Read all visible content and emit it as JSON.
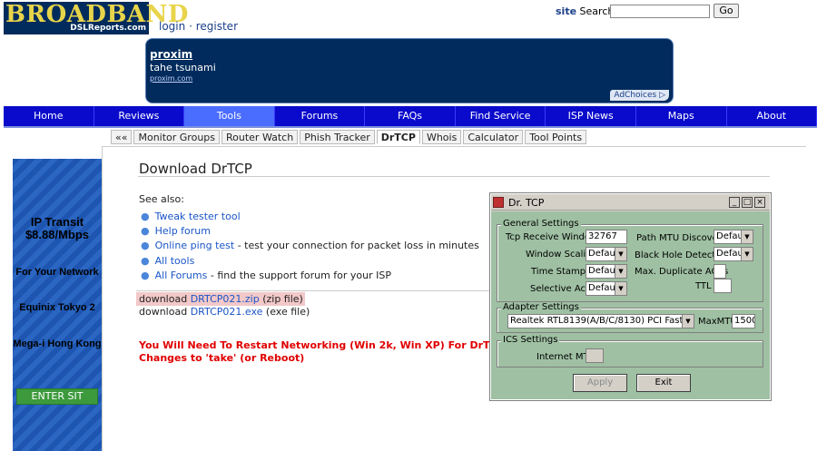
{
  "header": {
    "logo_big": "BROADBAND",
    "logo_small": "DSLReports.com",
    "login": "login",
    "sep": "·",
    "register": "register",
    "site_label": "site",
    "search_label": "Search:",
    "search_value": "",
    "go_label": "Go"
  },
  "ad": {
    "title": "proxim",
    "subtitle": "tahe tsunami",
    "url": "proxim.com",
    "choices": "AdChoices ▷"
  },
  "nav": [
    "Home",
    "Reviews",
    "Tools",
    "Forums",
    "FAQs",
    "Find Service",
    "ISP News",
    "Maps",
    "About"
  ],
  "subtabs": [
    "««",
    "Monitor Groups",
    "Router Watch",
    "Phish Tracker",
    "DrTCP",
    "Whois",
    "Calculator",
    "Tool Points"
  ],
  "leftad": {
    "line1": "IP Transit",
    "line2": "$8.88/Mbps",
    "line3": "For Your Network",
    "line4": "Equinix Tokyo 2",
    "line5": "Mega-i Hong Kong",
    "button": "ENTER SIT"
  },
  "main": {
    "title": "Download DrTCP",
    "see_also": "See also:",
    "links": [
      {
        "text": "Tweak tester tool",
        "desc": ""
      },
      {
        "text": "Help forum",
        "desc": ""
      },
      {
        "text": "Online ping test",
        "desc": " - test your connection for packet loss in minutes"
      },
      {
        "text": "All tools",
        "desc": ""
      },
      {
        "text": "All Forums",
        "desc": " - find the support forum for your ISP"
      }
    ],
    "dl1_prefix": "download ",
    "dl1_link": "DRTCP021.zip",
    "dl1_suffix": " (zip file)",
    "dl2_prefix": "download ",
    "dl2_link": "DRTCP021.exe",
    "dl2_suffix": " (exe file)",
    "warning_line1": "You Will Need To Restart Networking (Win 2k, Win XP) For DrTCP",
    "warning_line2": "Changes to 'take' (or Reboot)"
  },
  "drtcp": {
    "title": "Dr. TCP",
    "general_settings": "General Settings",
    "tcp_receive_window_label": "Tcp Receive Window",
    "tcp_receive_window_value": "32767",
    "window_scaling_label": "Window Scaling",
    "window_scaling_value": "Default",
    "time_stamping_label": "Time Stamping",
    "time_stamping_value": "Default",
    "selective_acks_label": "Selective Acks",
    "selective_acks_value": "Default",
    "path_mtu_label": "Path MTU Discovery",
    "path_mtu_value": "Default",
    "black_hole_label": "Black Hole Detection",
    "black_hole_value": "Default",
    "max_dup_acks_label": "Max. Duplicate ACKs",
    "ttl_label": "TTL",
    "adapter_settings": "Adapter Settings",
    "adapter_value": "Realtek RTL8139(A/B/C/8130) PCI Fast Etherne",
    "maxmtu_label": "MaxMTU",
    "maxmtu_value": "1500",
    "ics_settings": "ICS Settings",
    "internet_mtu_label": "Internet MTU",
    "apply_label": "Apply",
    "exit_label": "Exit"
  }
}
